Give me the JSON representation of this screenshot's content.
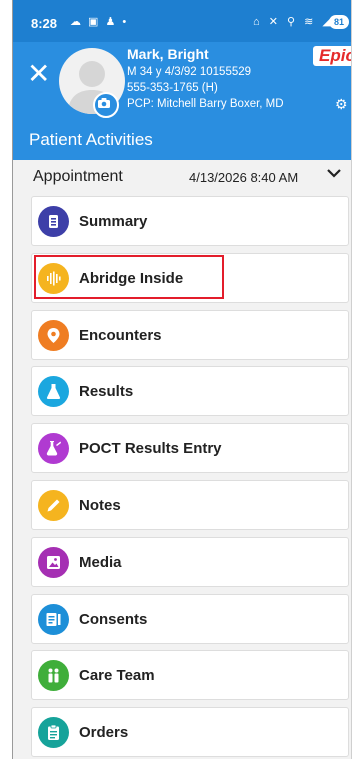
{
  "status_bar": {
    "time": "8:28",
    "battery": "81"
  },
  "patient": {
    "name": "Mark, Bright",
    "line1": "M 34 y 4/3/92 10155529",
    "phone": "555-353-1765 (H)",
    "pcp": "PCP: Mitchell Barry Boxer, MD"
  },
  "brand": {
    "logo_text": "Epic"
  },
  "section": {
    "title": "Patient Activities"
  },
  "appointment": {
    "label": "Appointment",
    "datetime": "4/13/2026  8:40 AM"
  },
  "activities": [
    {
      "label": "Summary",
      "icon": "summary-icon",
      "color": "#3d3fa8"
    },
    {
      "label": "Abridge Inside",
      "icon": "abridge-icon",
      "color": "#f5b41f"
    },
    {
      "label": "Encounters",
      "icon": "encounters-icon",
      "color": "#ef7d22"
    },
    {
      "label": "Results",
      "icon": "results-icon",
      "color": "#1ba7df"
    },
    {
      "label": "POCT Results Entry",
      "icon": "poct-icon",
      "color": "#b03ad1"
    },
    {
      "label": "Notes",
      "icon": "notes-icon",
      "color": "#f5b41f"
    },
    {
      "label": "Media",
      "icon": "media-icon",
      "color": "#a52fb3"
    },
    {
      "label": "Consents",
      "icon": "consents-icon",
      "color": "#1d8fd8"
    },
    {
      "label": "Care Team",
      "icon": "care-team-icon",
      "color": "#3fae3a"
    },
    {
      "label": "Orders",
      "icon": "orders-icon",
      "color": "#16a39a"
    }
  ],
  "colors": {
    "header_blue": "#2a8ee0",
    "status_blue": "#1e7fd0",
    "highlight_red": "#e31d2b"
  }
}
